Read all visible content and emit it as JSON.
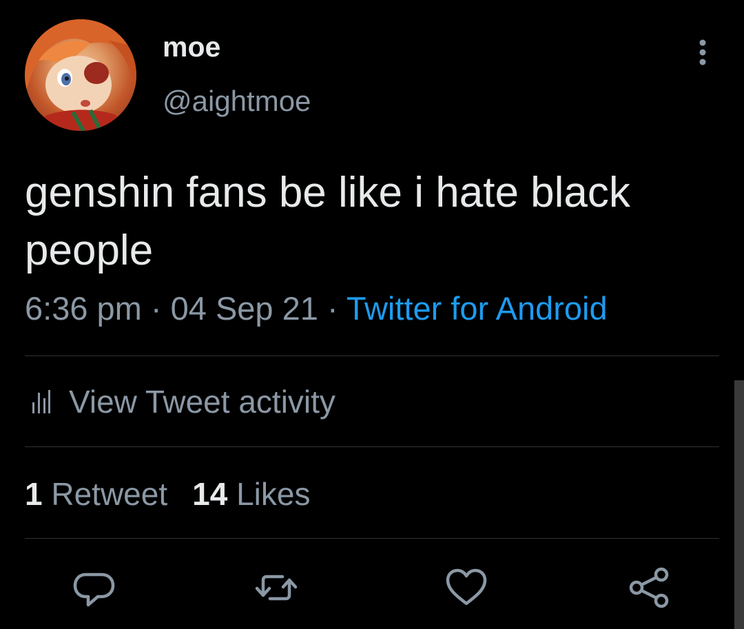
{
  "author": {
    "display_name": "moe",
    "handle": "@aightmoe",
    "avatar_icon": "anime-profile-avatar"
  },
  "tweet": {
    "text": "genshin fans be like i hate black people",
    "time": "6:36 pm",
    "separator": "·",
    "date": "04 Sep 21",
    "source": "Twitter for Android"
  },
  "activity": {
    "label": "View Tweet activity",
    "icon": "bar-chart-icon"
  },
  "stats": {
    "retweet_count": "1",
    "retweet_label": "Retweet",
    "like_count": "14",
    "like_label": "Likes"
  },
  "actions": [
    {
      "name": "reply",
      "icon": "reply-icon"
    },
    {
      "name": "retweet",
      "icon": "retweet-icon"
    },
    {
      "name": "like",
      "icon": "heart-icon"
    },
    {
      "name": "share",
      "icon": "share-icon"
    }
  ],
  "menu": {
    "icon": "more-vertical-icon"
  },
  "colors": {
    "background": "#000000",
    "primary_text": "#e7e9ea",
    "secondary_text": "#8b98a5",
    "link": "#1d9bf0",
    "divider": "#2f3336"
  }
}
